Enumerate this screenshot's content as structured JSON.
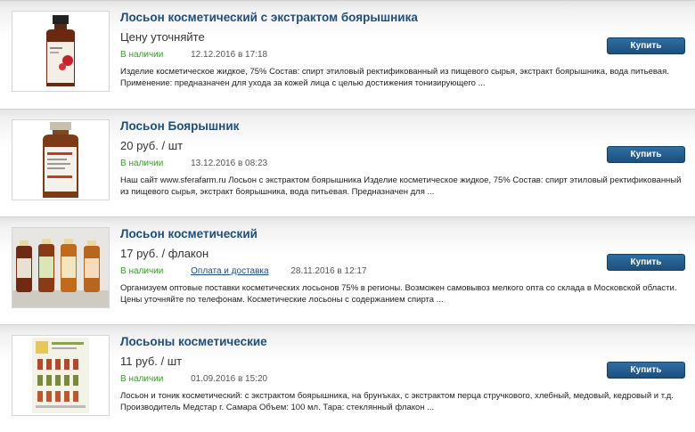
{
  "buy_label": "Купить",
  "products": [
    {
      "title": "Лосьон косметический с экстрактом боярышника",
      "price": "Цену уточняйте",
      "stock": "В наличии",
      "delivery": "",
      "date": "12.12.2016 в 17:18",
      "description": "Изделие косметическое жидкое, 75% Состав: спирт этиловый ректификованный из пищевого сырья, экстракт боярышника, вода питьевая. Применение: предназначен для ухода за кожей лица с целью достижения тонизирующего ..."
    },
    {
      "title": "Лосьон Боярышник",
      "price": "20 руб. / шт",
      "stock": "В наличии",
      "delivery": "",
      "date": "13.12.2016 в 08:23",
      "description": "Наш сайт www.sferafarm.ru Лосьон с экстрактом боярышника Изделие косметическое жидкое, 75% Состав: спирт этиловый ректификованный из пищевого сырья, экстракт боярышника, вода питьевая. Предназначен для ..."
    },
    {
      "title": "Лосьон косметический",
      "price": "17 руб. / флакон",
      "stock": "В наличии",
      "delivery": "Оплата и доставка",
      "date": "28.11.2016 в 12:17",
      "description": "Организуем оптовые поставки косметических лосьонов 75% в регионы. Возможен самовывоз мелкого опта со склада в Московской области. Цены уточняйте по телефонам. Косметические лосьоны с содержанием спирта ..."
    },
    {
      "title": "Лосьоны косметические",
      "price": "11 руб. / шт",
      "stock": "В наличии",
      "delivery": "",
      "date": "01.09.2016 в 15:20",
      "description": "Лосьон и тоник косметический: с экстрактом боярышника, на брунъках, с экстрактом перца стручкового, хлебный, медовый, кедровый и т.д. Производитель Медстар г. Самара Объем: 100 мл. Тара: стеклянный флакон ..."
    }
  ]
}
